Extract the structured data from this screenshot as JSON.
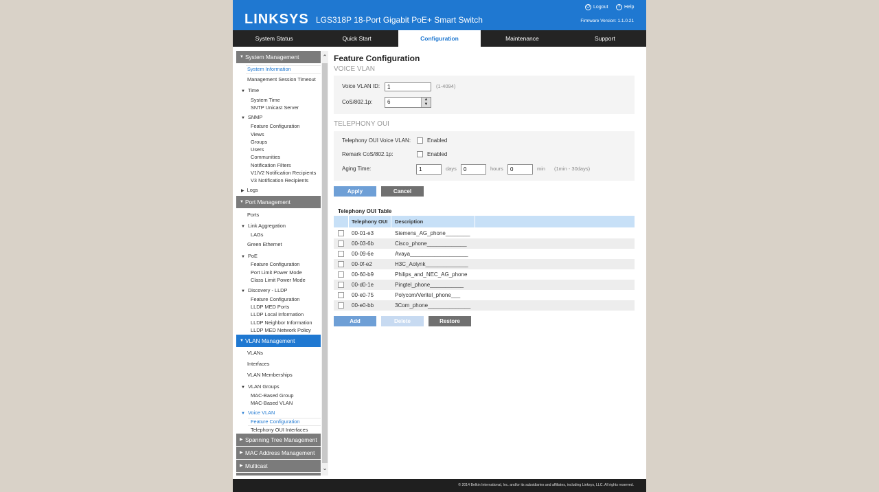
{
  "header": {
    "logo": "LINKSYS",
    "product": "LGS318P 18-Port Gigabit PoE+ Smart Switch",
    "logout": "Logout",
    "help": "Help",
    "firmware": "Firmware Version: 1.1.0.21"
  },
  "nav": {
    "tabs": [
      "System Status",
      "Quick Start",
      "Configuration",
      "Maintenance",
      "Support"
    ],
    "active": "Configuration"
  },
  "sidebar": {
    "system_management": "System Management",
    "system_information": "System Information",
    "mgmt_session_timeout": "Management Session Timeout",
    "time": "Time",
    "system_time": "System Time",
    "sntp": "SNTP Unicast Server",
    "snmp": "SNMP",
    "snmp_feature": "Feature Configuration",
    "views": "Views",
    "groups": "Groups",
    "users": "Users",
    "communities": "Communities",
    "notif_filters": "Notification Filters",
    "v1v2": "V1/V2 Notification Recipients",
    "v3": "V3 Notification Recipients",
    "logs": "Logs",
    "port_management": "Port Management",
    "ports": "Ports",
    "link_agg": "Link Aggregation",
    "lags": "LAGs",
    "green_eth": "Green Ethernet",
    "poe": "PoE",
    "poe_feature": "Feature Configuration",
    "port_limit": "Port Limit Power Mode",
    "class_limit": "Class Limit Power Mode",
    "lldp": "Discovery - LLDP",
    "lldp_feature": "Feature Configuration",
    "lldp_med_ports": "LLDP MED Ports",
    "lldp_local": "LLDP Local Information",
    "lldp_neighbor": "LLDP Neighbor Information",
    "lldp_med_policy": "LLDP MED Network Policy",
    "vlan_management": "VLAN Management",
    "vlans": "VLANs",
    "interfaces": "Interfaces",
    "vlan_memberships": "VLAN Memberships",
    "vlan_groups": "VLAN Groups",
    "mac_group": "MAC-Based Group",
    "mac_vlan": "MAC-Based VLAN",
    "voice_vlan": "Voice VLAN",
    "voice_feature": "Feature Configuration",
    "telephony_if": "Telephony OUI Interfaces",
    "spanning_tree": "Spanning Tree Management",
    "mac_address": "MAC Address Management",
    "multicast": "Multicast"
  },
  "main": {
    "title": "Feature Configuration",
    "voice_vlan_heading": "VOICE VLAN",
    "voice_vlan_id_label": "Voice VLAN ID:",
    "voice_vlan_id_value": "1",
    "voice_vlan_id_hint": "(1-4094)",
    "cos_label": "CoS/802.1p:",
    "cos_value": "6",
    "telephony_heading": "TELEPHONY OUI",
    "tel_voice_vlan_label": "Telephony OUI Voice VLAN:",
    "tel_voice_vlan_enabled": "Enabled",
    "remark_cos_label": "Remark CoS/802.1p:",
    "remark_cos_enabled": "Enabled",
    "aging_label": "Aging Time:",
    "aging_days": "1",
    "days": "days",
    "aging_hours": "0",
    "hours": "hours",
    "aging_min": "0",
    "min": "min",
    "aging_hint": "(1min - 30days)",
    "apply": "Apply",
    "cancel": "Cancel"
  },
  "table": {
    "title": "Telephony OUI Table",
    "headers": [
      "Telephony OUI",
      "Description"
    ],
    "rows": [
      {
        "oui": "00-01-e3",
        "desc": "Siemens_AG_phone________"
      },
      {
        "oui": "00-03-6b",
        "desc": "Cisco_phone_____________"
      },
      {
        "oui": "00-09-6e",
        "desc": "Avaya___________________"
      },
      {
        "oui": "00-0f-e2",
        "desc": "H3C_Aolynk______________"
      },
      {
        "oui": "00-60-b9",
        "desc": "Philips_and_NEC_AG_phone"
      },
      {
        "oui": "00-d0-1e",
        "desc": "Pingtel_phone___________"
      },
      {
        "oui": "00-e0-75",
        "desc": "Polycom/Veritel_phone___"
      },
      {
        "oui": "00-e0-bb",
        "desc": "3Com_phone______________"
      }
    ],
    "add": "Add",
    "delete": "Delete",
    "restore": "Restore"
  },
  "footer": {
    "copyright": "© 2014 Belkin International, Inc. and/or its subsidiaries and affiliates, including Linksys, LLC. All rights reserved."
  },
  "colors": {
    "brand_blue": "#1f78d1",
    "nav_dark": "#242424",
    "sidebar_section": "#7b7b7b",
    "table_header": "#c7e0f7"
  }
}
